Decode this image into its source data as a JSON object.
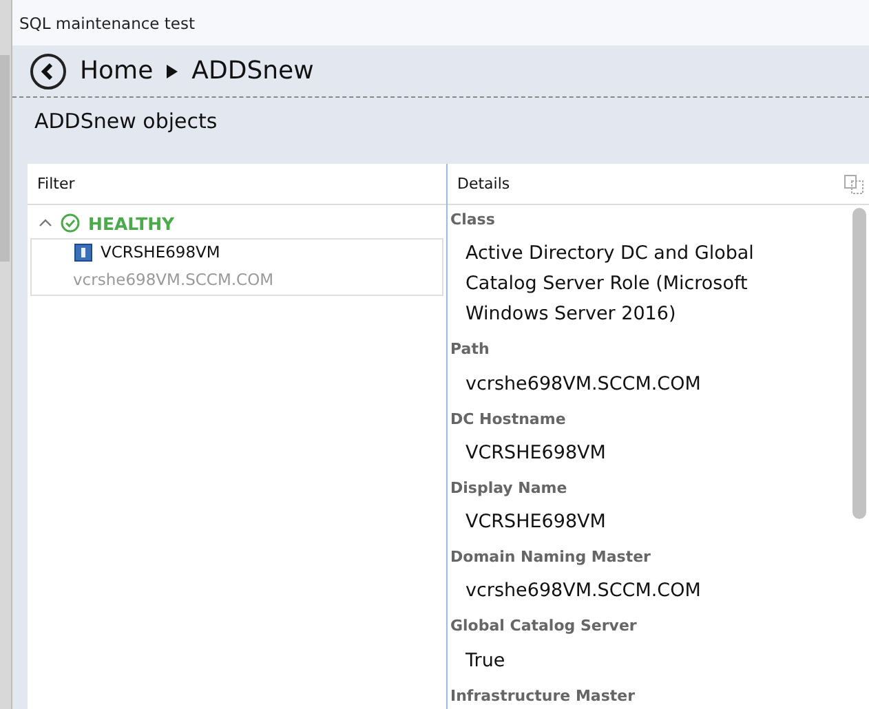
{
  "window": {
    "title": "SQL maintenance test"
  },
  "breadcrumb": [
    "Home",
    "ADDSnew"
  ],
  "section_title": "ADDSnew objects",
  "filter": {
    "header": "Filter",
    "groups": [
      {
        "label": "HEALTHY",
        "expanded": true,
        "items": [
          {
            "name": "VCRSHE698VM",
            "subtitle": "vcrshe698VM.SCCM.COM"
          }
        ]
      }
    ]
  },
  "details": {
    "header": "Details",
    "fields": [
      {
        "label": "Class",
        "value": "Active Directory DC and Global Catalog Server Role (Microsoft Windows Server 2016)"
      },
      {
        "label": "Path",
        "value": "vcrshe698VM.SCCM.COM"
      },
      {
        "label": "DC Hostname",
        "value": "VCRSHE698VM"
      },
      {
        "label": "Display Name",
        "value": "VCRSHE698VM"
      },
      {
        "label": "Domain Naming Master",
        "value": "vcrshe698VM.SCCM.COM"
      },
      {
        "label": "Global Catalog Server",
        "value": "True"
      },
      {
        "label": "Infrastructure Master"
      }
    ]
  }
}
